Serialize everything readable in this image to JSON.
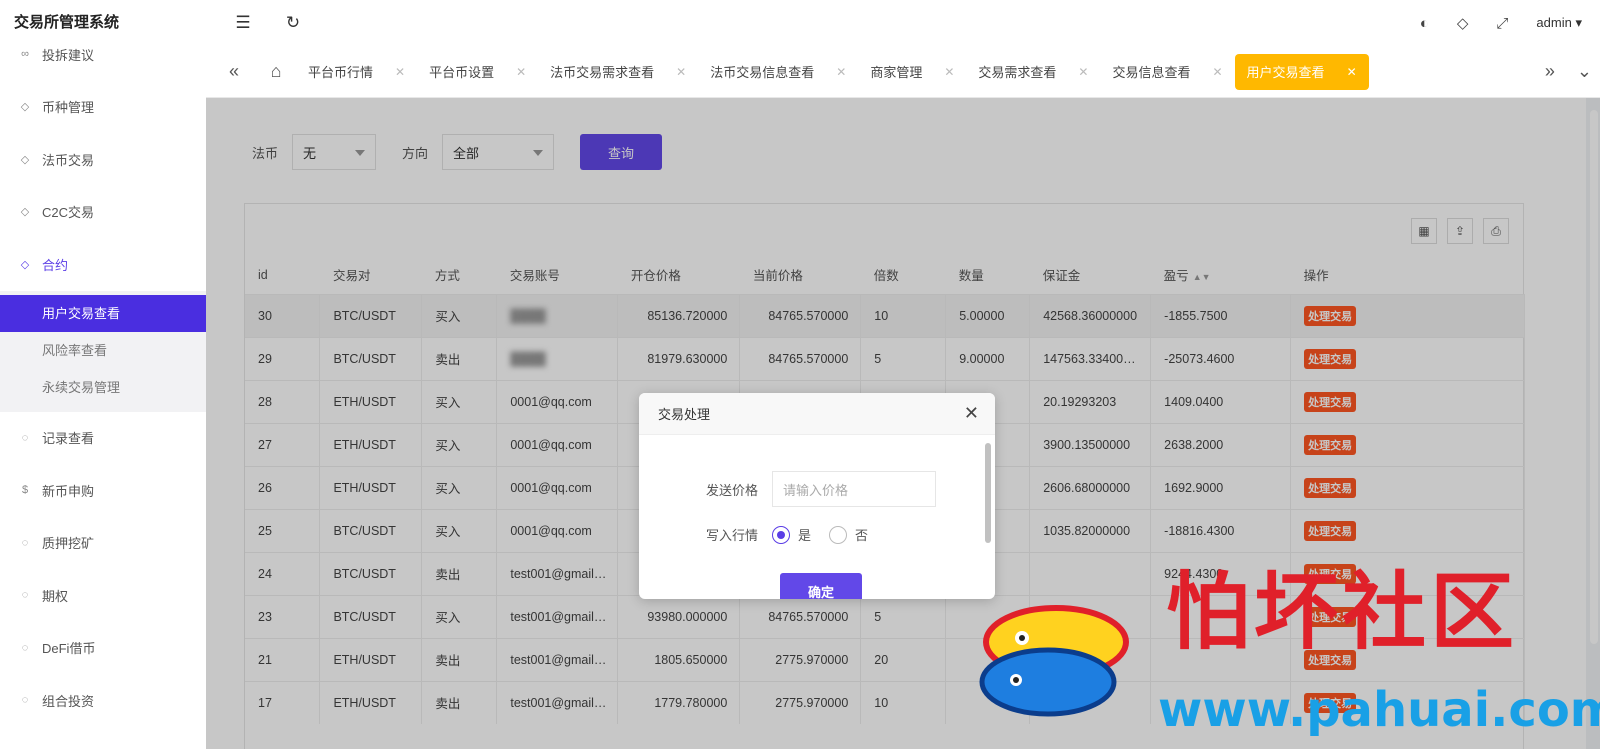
{
  "app": {
    "title": "交易所管理系统"
  },
  "sidebar": {
    "items": [
      {
        "label": "投拆建议",
        "icon": "link-icon"
      },
      {
        "label": "币种管理",
        "icon": "diamond-icon"
      },
      {
        "label": "法币交易",
        "icon": "diamond-icon"
      },
      {
        "label": "C2C交易",
        "icon": "diamond-icon"
      },
      {
        "label": "合约",
        "icon": "diamond-icon"
      }
    ],
    "subitems": [
      {
        "label": "用户交易查看"
      },
      {
        "label": "风险率查看"
      },
      {
        "label": "永续交易管理"
      }
    ],
    "items_after": [
      {
        "label": "记录查看",
        "icon": "circle-arrow-icon"
      },
      {
        "label": "新币申购",
        "icon": "dollar-circle-icon"
      },
      {
        "label": "质押挖矿",
        "icon": "circle-arrow-icon"
      },
      {
        "label": "期权",
        "icon": "circle-arrow-icon"
      },
      {
        "label": "DeFi借币",
        "icon": "circle-arrow-icon"
      },
      {
        "label": "组合投资",
        "icon": "circle-arrow-icon"
      }
    ]
  },
  "header": {
    "user": "admin"
  },
  "tabs": [
    {
      "label": "平台币行情"
    },
    {
      "label": "平台币设置"
    },
    {
      "label": "法币交易需求查看"
    },
    {
      "label": "法币交易信息查看"
    },
    {
      "label": "商家管理"
    },
    {
      "label": "交易需求查看"
    },
    {
      "label": "交易信息查看"
    },
    {
      "label": "用户交易查看"
    }
  ],
  "filter": {
    "fiat_label": "法币",
    "fiat_value": "无",
    "direction_label": "方向",
    "direction_value": "全部",
    "query_button": "查询"
  },
  "table": {
    "columns": [
      "id",
      "交易对",
      "方式",
      "交易账号",
      "开仓价格",
      "当前价格",
      "倍数",
      "数量",
      "保证金",
      "盈亏",
      "操作"
    ],
    "rows": [
      {
        "id": "30",
        "pair": "BTC/USDT",
        "side": "买入",
        "account": "",
        "open": "85136.720000",
        "current": "84765.570000",
        "lev": "10",
        "qty": "5.00000",
        "margin": "42568.36000000",
        "pnl": "-1855.7500",
        "action": "处理交易"
      },
      {
        "id": "29",
        "pair": "BTC/USDT",
        "side": "卖出",
        "account": "",
        "open": "81979.630000",
        "current": "84765.570000",
        "lev": "5",
        "qty": "9.00000",
        "margin": "147563.33400…",
        "pnl": "-25073.4600",
        "action": "处理交易"
      },
      {
        "id": "28",
        "pair": "ETH/USDT",
        "side": "买入",
        "account": "0001@qq.com",
        "open": "",
        "current": "",
        "lev": "",
        "qty": "",
        "margin": "20.19293203",
        "pnl": "1409.0400",
        "action": "处理交易"
      },
      {
        "id": "27",
        "pair": "ETH/USDT",
        "side": "买入",
        "account": "0001@qq.com",
        "open": "",
        "current": "",
        "lev": "",
        "qty": "",
        "margin": "3900.13500000",
        "pnl": "2638.2000",
        "action": "处理交易"
      },
      {
        "id": "26",
        "pair": "ETH/USDT",
        "side": "买入",
        "account": "0001@qq.com",
        "open": "",
        "current": "",
        "lev": "",
        "qty": "",
        "margin": "2606.68000000",
        "pnl": "1692.9000",
        "action": "处理交易"
      },
      {
        "id": "25",
        "pair": "BTC/USDT",
        "side": "买入",
        "account": "0001@qq.com",
        "open": "",
        "current": "",
        "lev": "",
        "qty": "",
        "margin": "1035.82000000",
        "pnl": "-18816.4300",
        "action": "处理交易"
      },
      {
        "id": "24",
        "pair": "BTC/USDT",
        "side": "卖出",
        "account": "test001@gmail…",
        "open": "",
        "current": "",
        "lev": "",
        "qty": "",
        "margin": "",
        "pnl": "9244.4300",
        "action": "处理交易"
      },
      {
        "id": "23",
        "pair": "BTC/USDT",
        "side": "买入",
        "account": "test001@gmail…",
        "open": "93980.000000",
        "current": "84765.570000",
        "lev": "5",
        "qty": "",
        "margin": "",
        "pnl": "",
        "action": "处理交易"
      },
      {
        "id": "21",
        "pair": "ETH/USDT",
        "side": "卖出",
        "account": "test001@gmail…",
        "open": "1805.650000",
        "current": "2775.970000",
        "lev": "20",
        "qty": "",
        "margin": "",
        "pnl": "",
        "action": "处理交易"
      },
      {
        "id": "17",
        "pair": "ETH/USDT",
        "side": "卖出",
        "account": "test001@gmail…",
        "open": "1779.780000",
        "current": "2775.970000",
        "lev": "10",
        "qty": "",
        "margin": "",
        "pnl": "",
        "action": "处理交易"
      }
    ]
  },
  "dialog": {
    "title": "交易处理",
    "price_label": "发送价格",
    "price_placeholder": "请输入价格",
    "market_label": "写入行情",
    "yes": "是",
    "no": "否",
    "confirm": "确定"
  },
  "watermark": {
    "title": "怕坏社区",
    "url": "www.pahuai.com"
  },
  "colors": {
    "primary": "#6248e8",
    "active_tab": "#ffb800",
    "badge": "#ff5722",
    "sidebar_active": "#4a2ee0"
  }
}
